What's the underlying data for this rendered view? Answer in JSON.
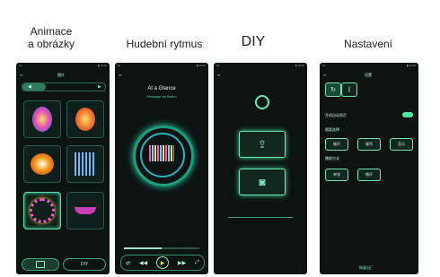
{
  "captions": {
    "animace": "Animace\na obrázky",
    "rytmus": "Hudební rytmus",
    "diy": "DIY",
    "nastaveni": "Nastavení"
  },
  "screen1": {
    "title": "图片",
    "tab_left": "◀",
    "tab_right": "▶",
    "nav_left_label": "",
    "nav_right_label": "DIY"
  },
  "screen2": {
    "song_title": "At a Glance",
    "song_artist": "Message by Beam",
    "controls": [
      "loop",
      "prev",
      "play",
      "next",
      "fullscreen"
    ]
  },
  "screen4": {
    "title": "设置",
    "toggle_label": "开机自动亮灯",
    "mode_label": "图案选择",
    "mode_options": [
      "循环",
      "顺序",
      "音乐"
    ],
    "speed_label": "播放方式",
    "speed_options": [
      "单张",
      "循环"
    ],
    "footer": "恢复出厂"
  },
  "colors": {
    "accent": "#4fe3a5",
    "bg": "#0c1412"
  }
}
